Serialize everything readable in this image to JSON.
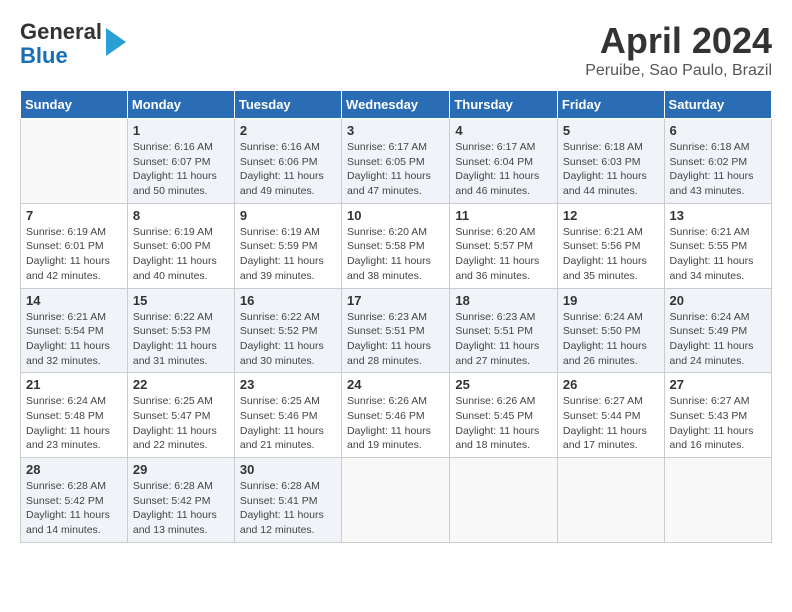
{
  "header": {
    "logo_line1": "General",
    "logo_line2": "Blue",
    "title": "April 2024",
    "subtitle": "Peruibe, Sao Paulo, Brazil"
  },
  "calendar": {
    "days_of_week": [
      "Sunday",
      "Monday",
      "Tuesday",
      "Wednesday",
      "Thursday",
      "Friday",
      "Saturday"
    ],
    "weeks": [
      [
        {
          "day": "",
          "info": ""
        },
        {
          "day": "1",
          "info": "Sunrise: 6:16 AM\nSunset: 6:07 PM\nDaylight: 11 hours\nand 50 minutes."
        },
        {
          "day": "2",
          "info": "Sunrise: 6:16 AM\nSunset: 6:06 PM\nDaylight: 11 hours\nand 49 minutes."
        },
        {
          "day": "3",
          "info": "Sunrise: 6:17 AM\nSunset: 6:05 PM\nDaylight: 11 hours\nand 47 minutes."
        },
        {
          "day": "4",
          "info": "Sunrise: 6:17 AM\nSunset: 6:04 PM\nDaylight: 11 hours\nand 46 minutes."
        },
        {
          "day": "5",
          "info": "Sunrise: 6:18 AM\nSunset: 6:03 PM\nDaylight: 11 hours\nand 44 minutes."
        },
        {
          "day": "6",
          "info": "Sunrise: 6:18 AM\nSunset: 6:02 PM\nDaylight: 11 hours\nand 43 minutes."
        }
      ],
      [
        {
          "day": "7",
          "info": "Sunrise: 6:19 AM\nSunset: 6:01 PM\nDaylight: 11 hours\nand 42 minutes."
        },
        {
          "day": "8",
          "info": "Sunrise: 6:19 AM\nSunset: 6:00 PM\nDaylight: 11 hours\nand 40 minutes."
        },
        {
          "day": "9",
          "info": "Sunrise: 6:19 AM\nSunset: 5:59 PM\nDaylight: 11 hours\nand 39 minutes."
        },
        {
          "day": "10",
          "info": "Sunrise: 6:20 AM\nSunset: 5:58 PM\nDaylight: 11 hours\nand 38 minutes."
        },
        {
          "day": "11",
          "info": "Sunrise: 6:20 AM\nSunset: 5:57 PM\nDaylight: 11 hours\nand 36 minutes."
        },
        {
          "day": "12",
          "info": "Sunrise: 6:21 AM\nSunset: 5:56 PM\nDaylight: 11 hours\nand 35 minutes."
        },
        {
          "day": "13",
          "info": "Sunrise: 6:21 AM\nSunset: 5:55 PM\nDaylight: 11 hours\nand 34 minutes."
        }
      ],
      [
        {
          "day": "14",
          "info": "Sunrise: 6:21 AM\nSunset: 5:54 PM\nDaylight: 11 hours\nand 32 minutes."
        },
        {
          "day": "15",
          "info": "Sunrise: 6:22 AM\nSunset: 5:53 PM\nDaylight: 11 hours\nand 31 minutes."
        },
        {
          "day": "16",
          "info": "Sunrise: 6:22 AM\nSunset: 5:52 PM\nDaylight: 11 hours\nand 30 minutes."
        },
        {
          "day": "17",
          "info": "Sunrise: 6:23 AM\nSunset: 5:51 PM\nDaylight: 11 hours\nand 28 minutes."
        },
        {
          "day": "18",
          "info": "Sunrise: 6:23 AM\nSunset: 5:51 PM\nDaylight: 11 hours\nand 27 minutes."
        },
        {
          "day": "19",
          "info": "Sunrise: 6:24 AM\nSunset: 5:50 PM\nDaylight: 11 hours\nand 26 minutes."
        },
        {
          "day": "20",
          "info": "Sunrise: 6:24 AM\nSunset: 5:49 PM\nDaylight: 11 hours\nand 24 minutes."
        }
      ],
      [
        {
          "day": "21",
          "info": "Sunrise: 6:24 AM\nSunset: 5:48 PM\nDaylight: 11 hours\nand 23 minutes."
        },
        {
          "day": "22",
          "info": "Sunrise: 6:25 AM\nSunset: 5:47 PM\nDaylight: 11 hours\nand 22 minutes."
        },
        {
          "day": "23",
          "info": "Sunrise: 6:25 AM\nSunset: 5:46 PM\nDaylight: 11 hours\nand 21 minutes."
        },
        {
          "day": "24",
          "info": "Sunrise: 6:26 AM\nSunset: 5:46 PM\nDaylight: 11 hours\nand 19 minutes."
        },
        {
          "day": "25",
          "info": "Sunrise: 6:26 AM\nSunset: 5:45 PM\nDaylight: 11 hours\nand 18 minutes."
        },
        {
          "day": "26",
          "info": "Sunrise: 6:27 AM\nSunset: 5:44 PM\nDaylight: 11 hours\nand 17 minutes."
        },
        {
          "day": "27",
          "info": "Sunrise: 6:27 AM\nSunset: 5:43 PM\nDaylight: 11 hours\nand 16 minutes."
        }
      ],
      [
        {
          "day": "28",
          "info": "Sunrise: 6:28 AM\nSunset: 5:42 PM\nDaylight: 11 hours\nand 14 minutes."
        },
        {
          "day": "29",
          "info": "Sunrise: 6:28 AM\nSunset: 5:42 PM\nDaylight: 11 hours\nand 13 minutes."
        },
        {
          "day": "30",
          "info": "Sunrise: 6:28 AM\nSunset: 5:41 PM\nDaylight: 11 hours\nand 12 minutes."
        },
        {
          "day": "",
          "info": ""
        },
        {
          "day": "",
          "info": ""
        },
        {
          "day": "",
          "info": ""
        },
        {
          "day": "",
          "info": ""
        }
      ]
    ]
  }
}
